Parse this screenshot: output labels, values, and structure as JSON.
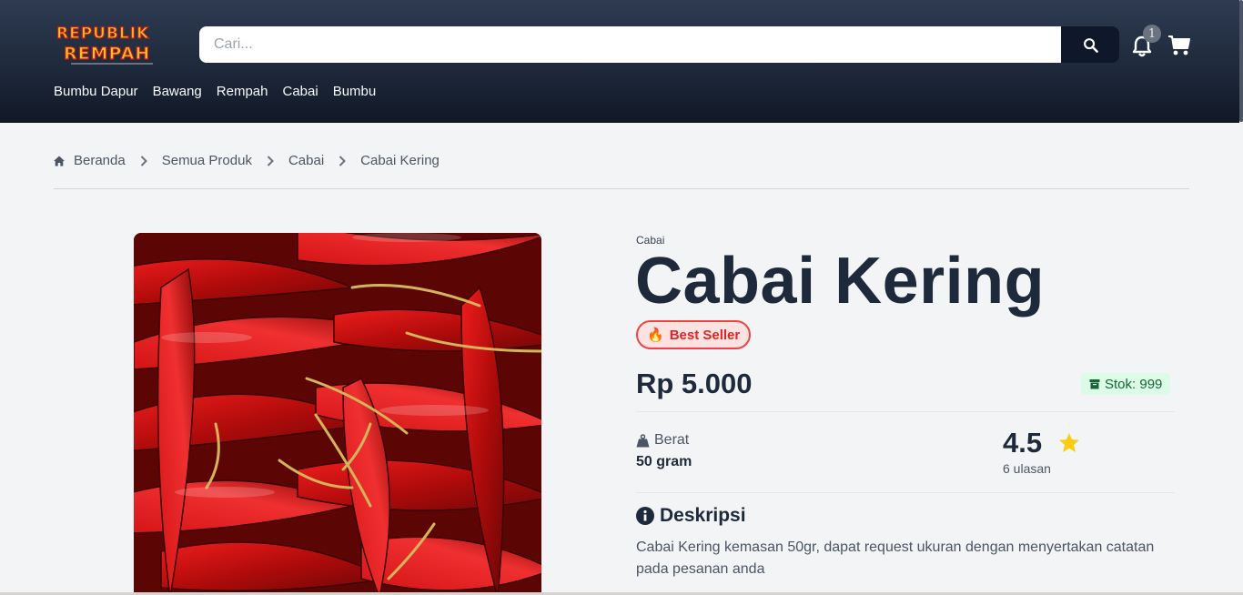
{
  "header": {
    "logo_alt": "REPUBLIK REMPAH",
    "search": {
      "placeholder": "Cari..."
    },
    "notification_count": "1",
    "nav": [
      "Bumbu Dapur",
      "Bawang",
      "Rempah",
      "Cabai",
      "Bumbu"
    ]
  },
  "breadcrumb": [
    "Beranda",
    "Semua Produk",
    "Cabai",
    "Cabai Kering"
  ],
  "product": {
    "category": "Cabai",
    "title": "Cabai Kering",
    "badge": "Best Seller",
    "badge_icon": "🔥",
    "price": "Rp 5.000",
    "stock_label": "Stok: 999",
    "weight_label": "Berat",
    "weight_value": "50 gram",
    "rating": "4.5",
    "reviews": "6 ulasan",
    "description_heading": "Deskripsi",
    "description": "Cabai Kering kemasan 50gr, dapat request ukuran dengan menyertakan catatan pada pesanan anda"
  },
  "colors": {
    "header_bg": "#1e293b",
    "primary_text": "#1e293b",
    "badge_red": "#ef4444",
    "stock_green": "#dcfce7",
    "star_yellow": "#facc15"
  },
  "icons": {
    "search": "search-icon",
    "bell": "bell-icon",
    "cart": "cart-icon",
    "home": "home-icon",
    "chevron": "chevron-right-icon",
    "box": "box-icon",
    "weight": "weight-icon",
    "star": "star-icon",
    "info": "info-icon"
  }
}
